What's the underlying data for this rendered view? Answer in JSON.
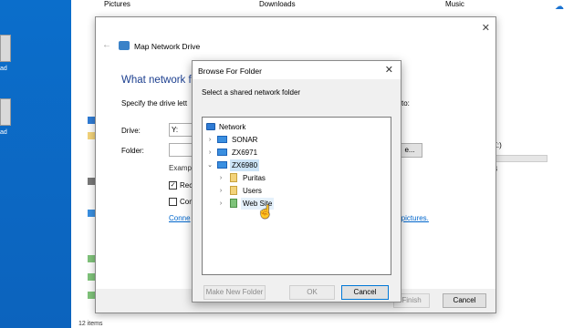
{
  "explorer": {
    "top_items": [
      "Pictures",
      "Downloads",
      "Music"
    ],
    "drive_partial": "Z:)",
    "drive_partial_sub": "B",
    "status": "12 items"
  },
  "desktop": {
    "labels": [
      "ad",
      "ad"
    ]
  },
  "map_drive": {
    "title": "Map Network Drive",
    "heading": "What network fo",
    "specify": "Specify the drive lett",
    "specify_end": "to:",
    "drive_label": "Drive:",
    "drive_value": "Y:",
    "folder_label": "Folder:",
    "browse_label": "e...",
    "example": "Examp",
    "reconnect": "Reco",
    "connect_other": "Con",
    "link_left": "Conne",
    "link_right": "d pictures.",
    "finish": "Finish",
    "cancel": "Cancel"
  },
  "browse": {
    "title": "Browse For Folder",
    "prompt": "Select a shared network folder",
    "tree": {
      "root": "Network",
      "computers": [
        "SONAR",
        "ZX6971",
        "ZX6980"
      ],
      "folders": [
        "Puritas",
        "Users",
        "Web Site"
      ]
    },
    "make_new": "Make New Folder",
    "ok": "OK",
    "cancel": "Cancel"
  }
}
